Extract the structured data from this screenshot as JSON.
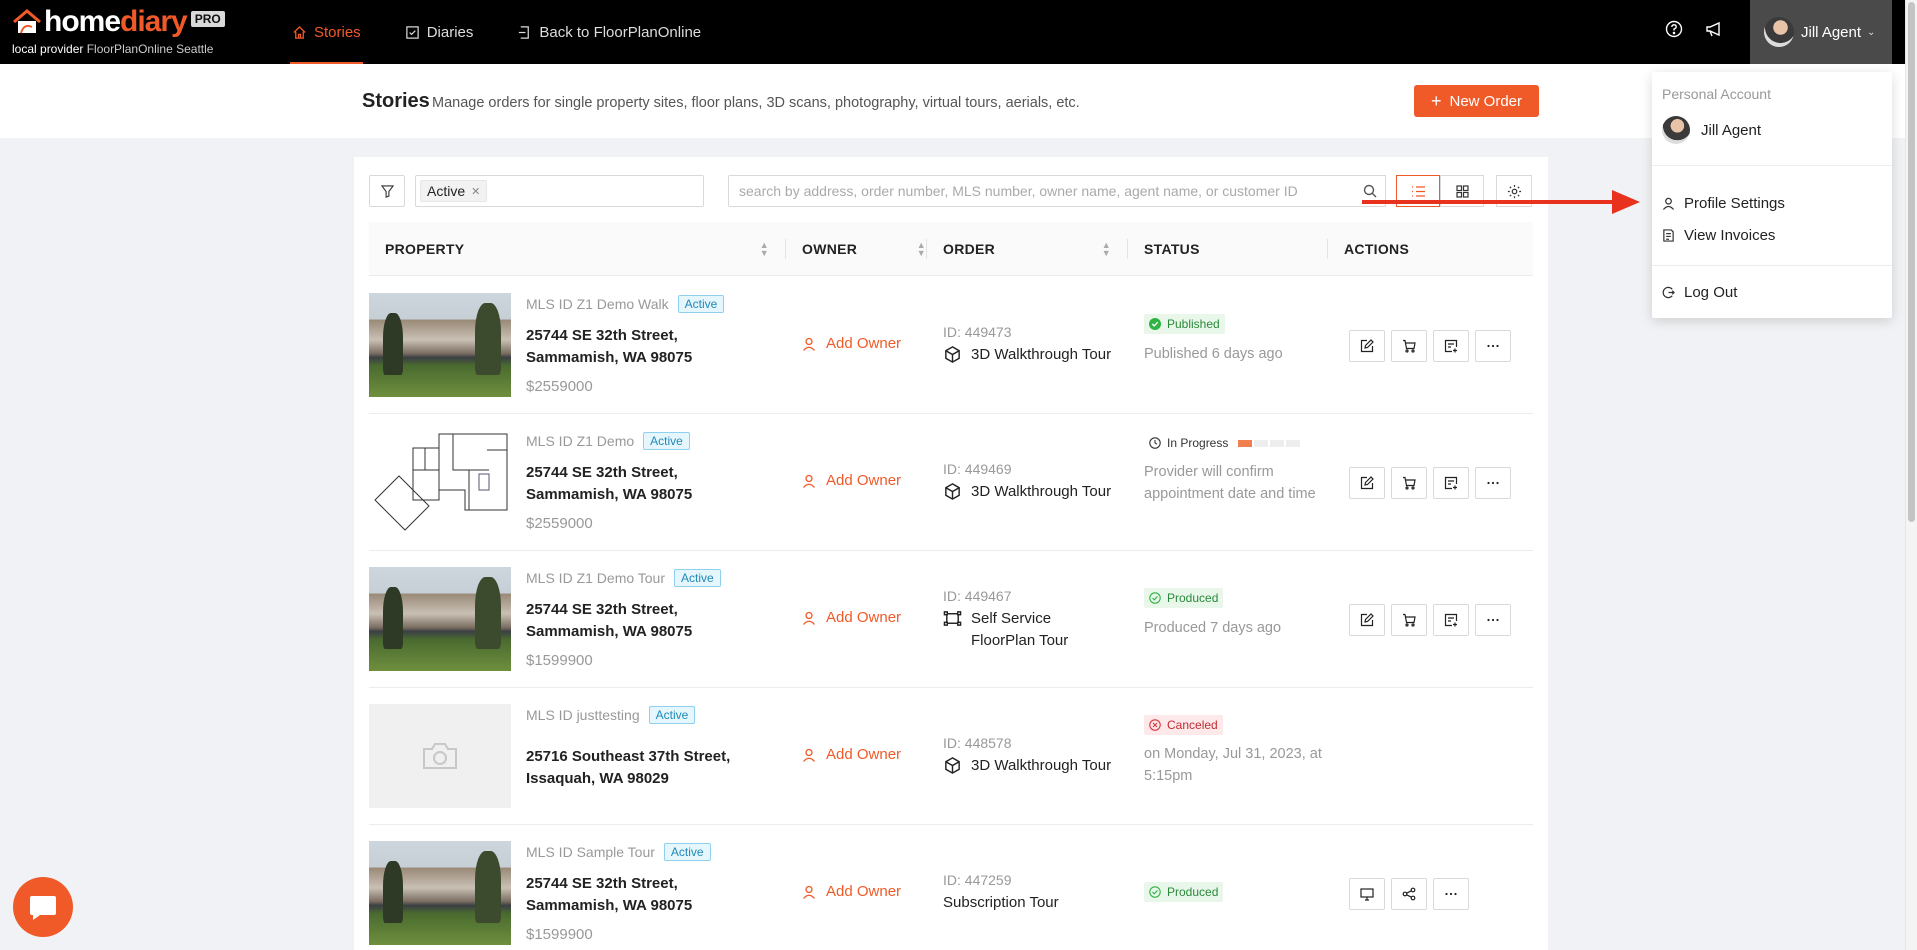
{
  "brand": {
    "home": "home",
    "diary": "diary",
    "pro": "PRO",
    "sub_prefix": "local provider",
    "provider": "FloorPlanOnline Seattle"
  },
  "nav": [
    {
      "label": "Stories",
      "icon": "home-icon",
      "active": true
    },
    {
      "label": "Diaries",
      "icon": "calendar-check-icon",
      "active": false
    },
    {
      "label": "Back to FloorPlanOnline",
      "icon": "exit-icon",
      "active": false
    }
  ],
  "topbar": {
    "help_icon": "question-circle-icon",
    "announce_icon": "megaphone-icon",
    "user_name": "Jill Agent"
  },
  "header": {
    "title": "Stories",
    "subtitle": "Manage orders for single property sites, floor plans, 3D scans, photography, virtual tours, aerials, etc.",
    "new_order": "New Order"
  },
  "filters": {
    "tag": "Active",
    "search_placeholder": "search by address, order number, MLS number, owner name, agent name, or customer ID"
  },
  "columns": {
    "property": "PROPERTY",
    "owner": "OWNER",
    "order": "ORDER",
    "status": "STATUS",
    "actions": "ACTIONS"
  },
  "rows": [
    {
      "mls": "MLS ID Z1 Demo Walk",
      "badge": "Active",
      "address": "25744 SE 32th Street, Sammamish, WA 98075",
      "price": "$2559000",
      "owner": "Add Owner",
      "order_id": "ID: 449473",
      "order_type": "3D Walkthrough Tour",
      "status": "Published",
      "status_detail": "Published 6 days ago"
    },
    {
      "mls": "MLS ID Z1 Demo",
      "badge": "Active",
      "address": "25744 SE 32th Street, Sammamish, WA 98075",
      "price": "$2559000",
      "owner": "Add Owner",
      "order_id": "ID: 449469",
      "order_type": "3D Walkthrough Tour",
      "status": "In Progress",
      "progress": 0.25,
      "status_detail": "Provider will confirm appointment date and time"
    },
    {
      "mls": "MLS ID Z1 Demo Tour",
      "badge": "Active",
      "address": "25744 SE 32th Street, Sammamish, WA 98075",
      "price": "$1599900",
      "owner": "Add Owner",
      "order_id": "ID: 449467",
      "order_type": "Self Service FloorPlan Tour",
      "status": "Produced",
      "status_detail": "Produced 7 days ago"
    },
    {
      "mls": "MLS ID justtesting",
      "badge": "Active",
      "address": "25716 Southeast 37th Street, Issaquah, WA 98029",
      "price": "",
      "owner": "Add Owner",
      "order_id": "ID: 448578",
      "order_type": "3D Walkthrough Tour",
      "status": "Canceled",
      "status_detail": "on Monday, Jul 31, 2023, at 5:15pm"
    },
    {
      "mls": "MLS ID Sample Tour",
      "badge": "Active",
      "address": "25744 SE 32th Street, Sammamish, WA 98075",
      "price": "$1599900",
      "owner": "Add Owner",
      "order_id": "ID: 447259",
      "order_type": "Subscription Tour",
      "status": "Produced",
      "status_detail": ""
    }
  ],
  "dropdown": {
    "section_label": "Personal Account",
    "user_name": "Jill Agent",
    "profile_settings": "Profile Settings",
    "view_invoices": "View Invoices",
    "log_out": "Log Out"
  },
  "colors": {
    "accent": "#f05a28",
    "topbar": "#000000",
    "success": "#2a8a3a",
    "danger": "#c22b33",
    "annotation_arrow": "#e8321e"
  }
}
